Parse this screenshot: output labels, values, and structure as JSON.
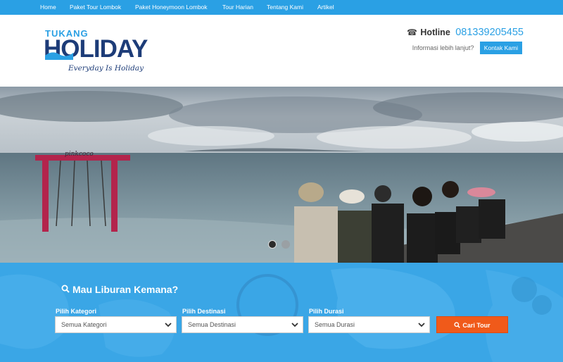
{
  "nav": {
    "items": [
      {
        "label": "Home"
      },
      {
        "label": "Paket Tour Lombok"
      },
      {
        "label": "Paket Honeymoon Lombok"
      },
      {
        "label": "Tour Harian"
      },
      {
        "label": "Tentang Kami"
      },
      {
        "label": "Artikel"
      }
    ]
  },
  "header": {
    "logo": {
      "top": "TUKANG",
      "main": "HOLIDAY",
      "tagline": "Everyday Is Holiday"
    },
    "hotline_label": "Hotline",
    "hotline_number": "081339205455",
    "info_text": "Informasi lebih lanjut?",
    "contact_button": "Kontak Kami"
  },
  "hero": {
    "slides": 2,
    "active_slide": 1,
    "swing_sign": "pinkcoco"
  },
  "search": {
    "title": "Mau Liburan Kemana?",
    "category_label": "Pilih Kategori",
    "category_value": "Semua Kategori",
    "destination_label": "Pilih Destinasi",
    "destination_value": "Semua Destinasi",
    "duration_label": "Pilih Durasi",
    "duration_value": "Semua Durasi",
    "button_label": "Cari Tour"
  },
  "colors": {
    "nav": "#2aa0e4",
    "brand_dark": "#1d3c78",
    "accent": "#2aa0e4",
    "search_bg": "#3aa6e6",
    "search_button": "#f05a1a"
  }
}
